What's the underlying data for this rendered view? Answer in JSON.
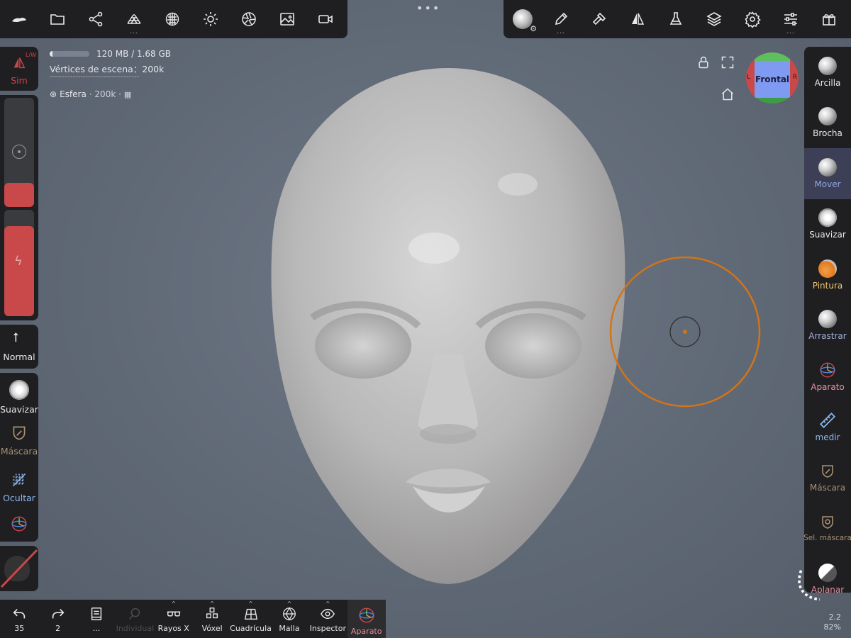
{
  "top_left_tools": [
    {
      "name": "logo",
      "icon": "nomad-logo-icon"
    },
    {
      "name": "files",
      "icon": "folder-icon"
    },
    {
      "name": "scene",
      "icon": "scene-graph-icon"
    },
    {
      "name": "topology",
      "icon": "mesh-topology-icon",
      "dots": "..."
    },
    {
      "name": "material",
      "icon": "material-sphere-icon"
    },
    {
      "name": "light",
      "icon": "sun-icon"
    },
    {
      "name": "camera-settings",
      "icon": "aperture-icon"
    },
    {
      "name": "background",
      "icon": "image-icon"
    },
    {
      "name": "camera",
      "icon": "video-camera-icon"
    }
  ],
  "top_right_tools": [
    {
      "name": "tool-preview",
      "icon": "brush-sphere-icon"
    },
    {
      "name": "stroke",
      "icon": "pen-icon",
      "dots": "..."
    },
    {
      "name": "painting",
      "icon": "hammer-icon"
    },
    {
      "name": "symmetry",
      "icon": "symmetry-icon"
    },
    {
      "name": "postprocess",
      "icon": "flask-icon"
    },
    {
      "name": "layers",
      "icon": "layers-icon"
    },
    {
      "name": "settings",
      "icon": "gear-icon"
    },
    {
      "name": "interface",
      "icon": "sliders-icon",
      "dots": "..."
    },
    {
      "name": "gift",
      "icon": "gift-icon"
    }
  ],
  "info": {
    "memory": "120 MB / 1.68 GB",
    "memory_fraction": 0.07,
    "vertices": "Vértices de escena：200k",
    "separator": "-----------------------------------",
    "object_name": "Esfera",
    "object_detail": " · 200k · "
  },
  "left": {
    "sym_badge": "L/W",
    "sym_label": "Sim",
    "normal_label": "Normal",
    "smooth_label": "Suavizar",
    "mask_label": "Máscara",
    "hide_label": "Ocultar",
    "radius_fraction": 0.22,
    "intensity_fraction": 0.85
  },
  "right_tools": [
    {
      "label": "Arcilla",
      "color": "#e8e8e8"
    },
    {
      "label": "Brocha",
      "color": "#e8e8e8"
    },
    {
      "label": "Mover",
      "color": "#8fa6e8",
      "active": true
    },
    {
      "label": "Suavizar",
      "color": "#e8e8e8"
    },
    {
      "label": "Pintura",
      "color": "#f2c66a"
    },
    {
      "label": "Arrastrar",
      "color": "#a3acd8"
    },
    {
      "label": "Aparato",
      "color": "#e68fa0"
    },
    {
      "label": "medir",
      "color": "#8fb7ef"
    },
    {
      "label": "Máscara",
      "color": "#a88f73"
    },
    {
      "label": "Sel. máscara",
      "color": "#a88f73"
    },
    {
      "label": "Aplanar",
      "color": "#e68fa0"
    }
  ],
  "gizmo": {
    "label": "Frontal",
    "left_face": "L",
    "right_face": "R"
  },
  "bottom_tools": [
    {
      "label": "35",
      "icon": "undo-icon"
    },
    {
      "label": "2",
      "icon": "redo-icon"
    },
    {
      "label": "...",
      "icon": "book-icon"
    },
    {
      "label": "Individual",
      "icon": "search-icon",
      "disabled": true
    },
    {
      "label": "Rayos X",
      "icon": "glasses-icon",
      "caret": true
    },
    {
      "label": "Vóxel",
      "icon": "cubes-icon",
      "caret": true
    },
    {
      "label": "Cuadrícula",
      "icon": "grid-plane-icon",
      "caret": true
    },
    {
      "label": "Malla",
      "icon": "wireframe-icon",
      "caret": true
    },
    {
      "label": "Inspector",
      "icon": "eye-icon",
      "caret": true
    },
    {
      "label": "Aparato",
      "icon": "gizmo-icon",
      "accent": true
    }
  ],
  "stats": {
    "version": "2.2",
    "zoom": "82%"
  },
  "colors": {
    "accent_red": "#c9484a",
    "brush_orange": "#d27418",
    "panel": "#1f1f21",
    "active_blue": "#8fa6e8"
  }
}
